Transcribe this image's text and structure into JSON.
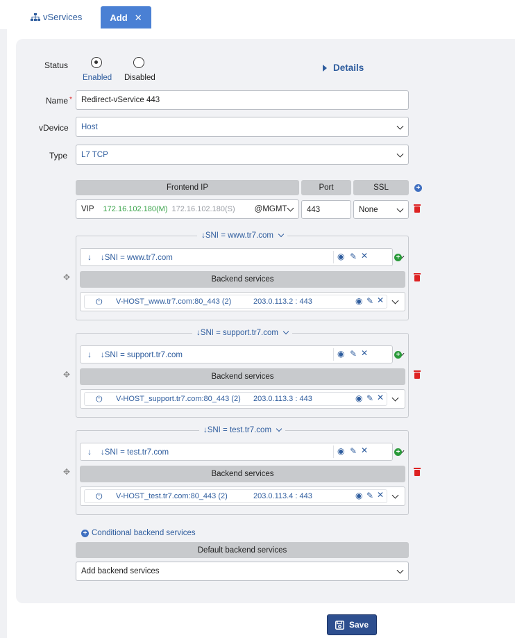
{
  "tabs": {
    "vservices": "vServices",
    "add": "Add"
  },
  "status": {
    "label": "Status",
    "enabled": "Enabled",
    "disabled": "Disabled",
    "details": "Details"
  },
  "name": {
    "label": "Name",
    "value": "Redirect-vService 443"
  },
  "vdevice": {
    "label": "vDevice",
    "value": "Host"
  },
  "type": {
    "label": "Type",
    "value": "L7 TCP"
  },
  "frontend": {
    "header_ip": "Frontend IP",
    "header_port": "Port",
    "header_ssl": "SSL",
    "vip_label": "VIP",
    "vip_primary": "172.16.102.180(M)",
    "vip_secondary": "172.16.102.180(S)",
    "vip_mgmt": "@MGMT",
    "port": "443",
    "ssl": "None"
  },
  "groups": [
    {
      "title": "↓SNI = www.tr7.com",
      "sni": "↓SNI = www.tr7.com",
      "backend_header": "Backend services",
      "service": "V-HOST_www.tr7.com:80_443 (2)",
      "address": "203.0.113.2 : 443"
    },
    {
      "title": "↓SNI = support.tr7.com",
      "sni": "↓SNI = support.tr7.com",
      "backend_header": "Backend services",
      "service": "V-HOST_support.tr7.com:80_443 (2)",
      "address": "203.0.113.3 : 443"
    },
    {
      "title": "↓SNI = test.tr7.com",
      "sni": "↓SNI = test.tr7.com",
      "backend_header": "Backend services",
      "service": "V-HOST_test.tr7.com:80_443 (2)",
      "address": "203.0.113.4 : 443"
    }
  ],
  "conditional": "Conditional backend services",
  "default_backend": {
    "header": "Default backend services",
    "value": "Add backend services"
  },
  "save": "Save",
  "colors": {
    "accent": "#4a80d4",
    "link": "#2f5d9e",
    "ok": "#3aa34a",
    "danger": "#dd2222",
    "save": "#2e4f8f"
  }
}
